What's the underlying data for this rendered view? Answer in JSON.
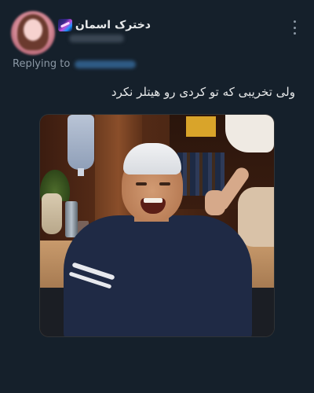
{
  "tweet": {
    "display_name": "دخترک اسمان",
    "name_emoji": "galaxy-emoji",
    "replying_to_label": "Replying to",
    "text": "ولی تخریبی که تو کردی رو هیتلر نکرد",
    "more_icon": "more-vertical-icon"
  },
  "colors": {
    "background": "#15202b",
    "text_primary": "#e7e9ea",
    "text_secondary": "#8b98a5",
    "border": "#2f3336"
  }
}
